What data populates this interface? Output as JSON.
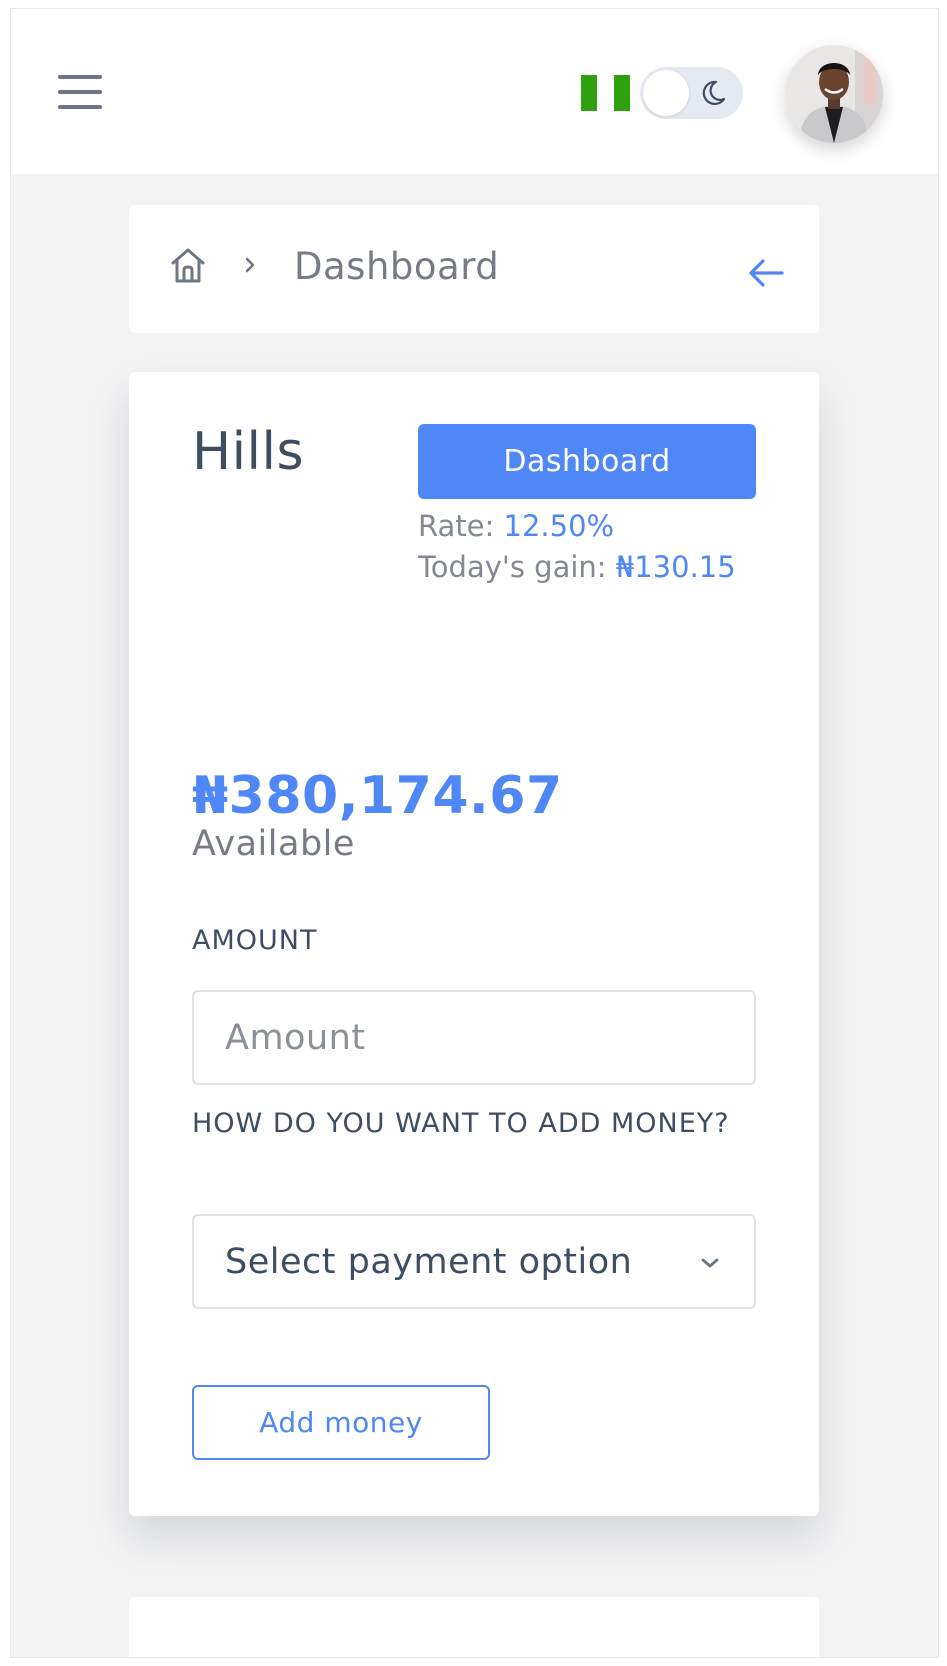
{
  "header": {
    "menu_icon": "hamburger-menu-icon",
    "flag_icon": "nigeria-flag-icon",
    "theme_toggle_icon": "moon-icon",
    "avatar_icon": "user-avatar",
    "dark_mode_enabled": false
  },
  "breadcrumb": {
    "home_icon": "home-icon",
    "separator_icon": "chevron-right-icon",
    "current": "Dashboard",
    "back_icon": "arrow-left-icon"
  },
  "account": {
    "name": "Hills",
    "dashboard_button": "Dashboard",
    "rate_label": "Rate:",
    "rate_value": "12.50%",
    "gain_label": "Today's gain:",
    "gain_value": "₦130.15",
    "balance": "₦380,174.67",
    "balance_label": "Available"
  },
  "form": {
    "amount_label": "AMOUNT",
    "amount_placeholder": "Amount",
    "method_label": "HOW DO YOU WANT TO ADD MONEY?",
    "method_selected": "Select payment option",
    "method_chevron_icon": "chevron-down-icon",
    "submit_label": "Add money"
  },
  "colors": {
    "accent": "#4f87f6",
    "text_dark": "#3f4d63",
    "text_muted": "#767c86",
    "background": "#f3f3f4",
    "flag_green": "#2fa10f"
  }
}
